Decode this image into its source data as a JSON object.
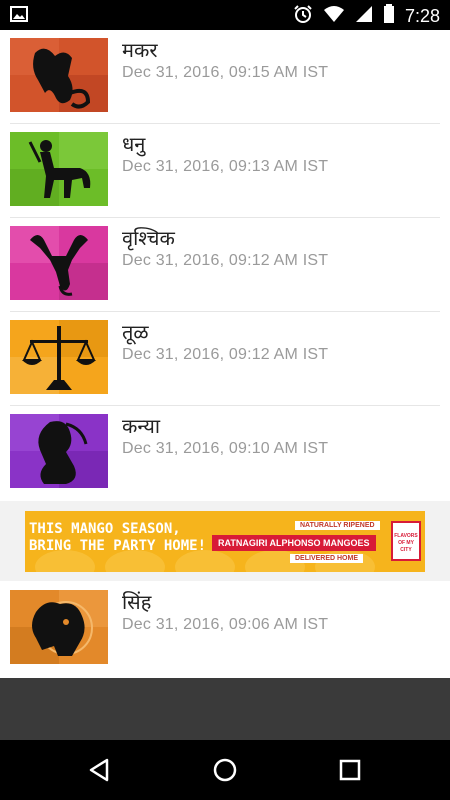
{
  "status_bar": {
    "time": "7:28",
    "icons": [
      "image-icon",
      "alarm-icon",
      "wifi-icon",
      "signal-icon",
      "battery-icon"
    ]
  },
  "items": [
    {
      "title": "मकर",
      "date": "Dec 31, 2016, 09:15 AM IST",
      "sign": "capricorn",
      "color": "#d2542b"
    },
    {
      "title": "धनु",
      "date": "Dec 31, 2016, 09:13 AM IST",
      "sign": "sagittarius",
      "color": "#6cbd28"
    },
    {
      "title": "वृश्चिक",
      "date": "Dec 31, 2016, 09:12 AM IST",
      "sign": "scorpio",
      "color": "#d9389f"
    },
    {
      "title": "तूळ",
      "date": "Dec 31, 2016, 09:12 AM IST",
      "sign": "libra",
      "color": "#f5a51c"
    },
    {
      "title": "कन्या",
      "date": "Dec 31, 2016, 09:10 AM IST",
      "sign": "virgo",
      "color": "#8a33c7"
    },
    {
      "title": "सिंह",
      "date": "Dec 31, 2016, 09:06 AM IST",
      "sign": "leo",
      "color": "#e3892a"
    }
  ],
  "ad": {
    "line1": "THIS MANGO SEASON,",
    "line2": "BRING THE PARTY HOME!",
    "tag1": "NATURALLY RIPENED",
    "tag2": "RATNAGIRI ALPHONSO MANGOES",
    "tag3": "DELIVERED HOME",
    "brand": "FLAVORS OF MY CITY",
    "bg_color": "#f6b41c"
  },
  "nav": {
    "back": "back-icon",
    "home": "home-icon",
    "recents": "recents-icon"
  }
}
